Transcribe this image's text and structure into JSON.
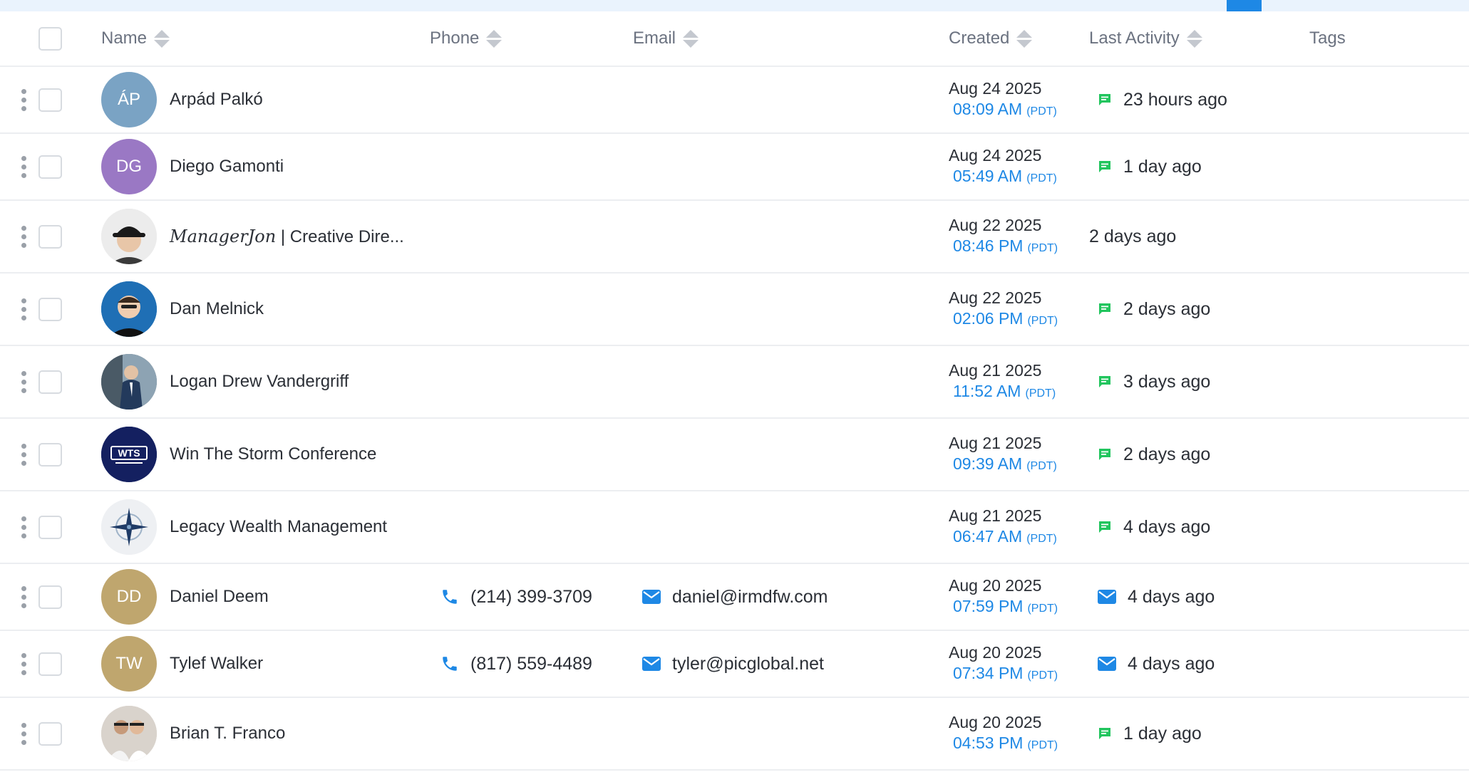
{
  "header": {
    "name": "Name",
    "phone": "Phone",
    "email": "Email",
    "created": "Created",
    "last_activity": "Last Activity",
    "tags": "Tags"
  },
  "colors": {
    "accent": "#1e88e5",
    "activity_message": "#22c55e",
    "text": "#2b2f36",
    "header_text": "#6b7280"
  },
  "rows": [
    {
      "initials": "ÁP",
      "avatar_color": "#7aa3c4",
      "avatar_kind": "initials",
      "name": "Arpád Palkó",
      "phone": "",
      "email": "",
      "date": "Aug 24 2025",
      "time": "08:09 AM",
      "tz": "(PDT)",
      "activity_icon": "message-icon",
      "activity": "23 hours ago"
    },
    {
      "initials": "DG",
      "avatar_color": "#9a78c4",
      "avatar_kind": "initials",
      "name": "Diego Gamonti",
      "phone": "",
      "email": "",
      "date": "Aug 24 2025",
      "time": "05:49 AM",
      "tz": "(PDT)",
      "activity_icon": "message-icon",
      "activity": "1 day ago"
    },
    {
      "initials": "",
      "avatar_color": "#e9e9e9",
      "avatar_kind": "photo-cap",
      "name_italic": "ManagerJon",
      "name": " | Creative Dire...",
      "phone": "",
      "email": "",
      "date": "Aug 22 2025",
      "time": "08:46 PM",
      "tz": "(PDT)",
      "activity_icon": "",
      "activity": "2 days ago"
    },
    {
      "initials": "",
      "avatar_color": "#1f6fb5",
      "avatar_kind": "photo-blue",
      "name": "Dan Melnick",
      "phone": "",
      "email": "",
      "date": "Aug 22 2025",
      "time": "02:06 PM",
      "tz": "(PDT)",
      "activity_icon": "message-icon",
      "activity": "2 days ago"
    },
    {
      "initials": "",
      "avatar_color": "#5b6b78",
      "avatar_kind": "photo-suit",
      "name": "Logan Drew Vandergriff",
      "phone": "",
      "email": "",
      "date": "Aug 21 2025",
      "time": "11:52 AM",
      "tz": "(PDT)",
      "activity_icon": "message-icon",
      "activity": "3 days ago"
    },
    {
      "initials": "WTS",
      "avatar_color": "#142060",
      "avatar_kind": "logo-wts",
      "name": "Win The Storm Conference",
      "phone": "",
      "email": "",
      "date": "Aug 21 2025",
      "time": "09:39 AM",
      "tz": "(PDT)",
      "activity_icon": "message-icon",
      "activity": "2 days ago"
    },
    {
      "initials": "",
      "avatar_color": "#eef0f3",
      "avatar_kind": "logo-compass",
      "name": "Legacy Wealth Management",
      "phone": "",
      "email": "",
      "date": "Aug 21 2025",
      "time": "06:47 AM",
      "tz": "(PDT)",
      "activity_icon": "message-icon",
      "activity": "4 days ago"
    },
    {
      "initials": "DD",
      "avatar_color": "#bfa66e",
      "avatar_kind": "initials",
      "name": "Daniel Deem",
      "phone": "(214) 399-3709",
      "email": "daniel@irmdfw.com",
      "date": "Aug 20 2025",
      "time": "07:59 PM",
      "tz": "(PDT)",
      "activity_icon": "mail-icon",
      "activity": "4 days ago"
    },
    {
      "initials": "TW",
      "avatar_color": "#bfa66e",
      "avatar_kind": "initials",
      "name": "Tylef Walker",
      "phone": "(817) 559-4489",
      "email": "tyler@picglobal.net",
      "date": "Aug 20 2025",
      "time": "07:34 PM",
      "tz": "(PDT)",
      "activity_icon": "mail-icon",
      "activity": "4 days ago"
    },
    {
      "initials": "",
      "avatar_color": "#d9d3cc",
      "avatar_kind": "photo-couple",
      "name": "Brian T. Franco",
      "phone": "",
      "email": "",
      "date": "Aug 20 2025",
      "time": "04:53 PM",
      "tz": "(PDT)",
      "activity_icon": "message-icon",
      "activity": "1 day ago"
    }
  ]
}
